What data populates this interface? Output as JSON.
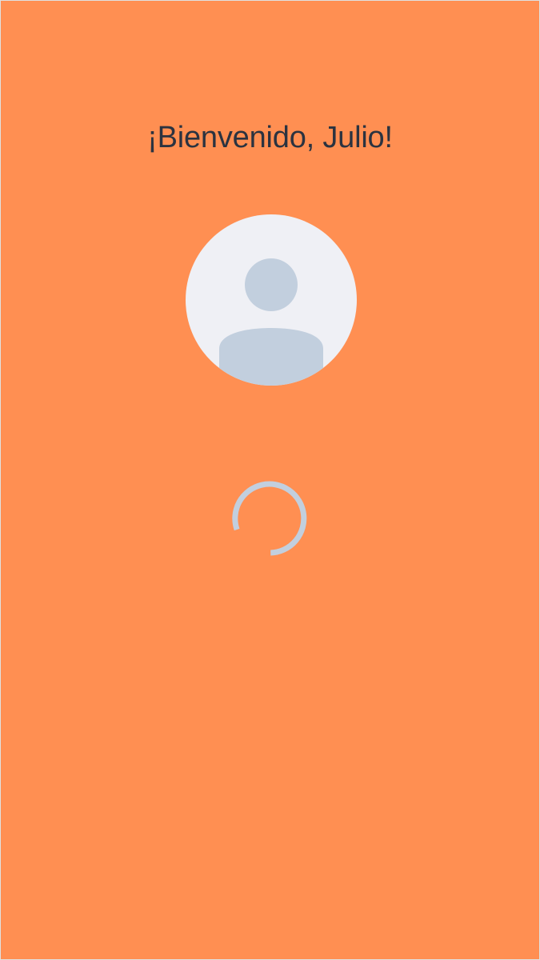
{
  "screen": {
    "background_color": "#FF8F52",
    "border_color": "#E0E0E0"
  },
  "welcome": {
    "title": "¡Bienvenido, Julio!",
    "text_color": "#2B3340"
  },
  "avatar": {
    "icon": "user-placeholder-icon",
    "background_color": "#EFF0F5",
    "silhouette_color": "#C2CFDE"
  },
  "loading": {
    "icon": "loading-spinner-icon",
    "color": "#C2CFDE"
  }
}
